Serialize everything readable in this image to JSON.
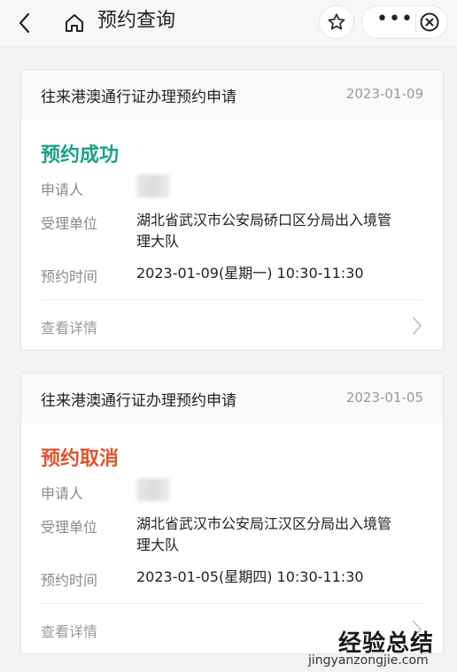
{
  "header": {
    "title": "预约查询",
    "icons": {
      "back": "chevron-left-icon",
      "home": "home-icon",
      "star": "star-icon",
      "more": "more-icon",
      "close": "close-circle-icon"
    },
    "more_glyph": "•••"
  },
  "appointments": [
    {
      "title": "往来港澳通行证办理预约申请",
      "date": "2023-01-09",
      "status": "预约成功",
      "status_color": "#1aa189",
      "applicant_label": "申请人",
      "office_label": "受理单位",
      "office_line1": "湖北省武汉市公安局硚口区分局出入境管",
      "office_line2": "理大队",
      "time_label": "预约时间",
      "time_value": "2023-01-09(星期一) 10:30-11:30",
      "detail_label": "查看详情"
    },
    {
      "title": "往来港澳通行证办理预约申请",
      "date": "2023-01-05",
      "status": "预约取消",
      "status_color": "#e0542a",
      "applicant_label": "申请人",
      "office_label": "受理单位",
      "office_line1": "湖北省武汉市公安局江汉区分局出入境管",
      "office_line2": "理大队",
      "time_label": "预约时间",
      "time_value": "2023-01-05(星期四) 10:30-11:30",
      "detail_label": "查看详情"
    }
  ],
  "watermark": {
    "main": "经验总结",
    "sub": "jingyanzongjie.com"
  }
}
